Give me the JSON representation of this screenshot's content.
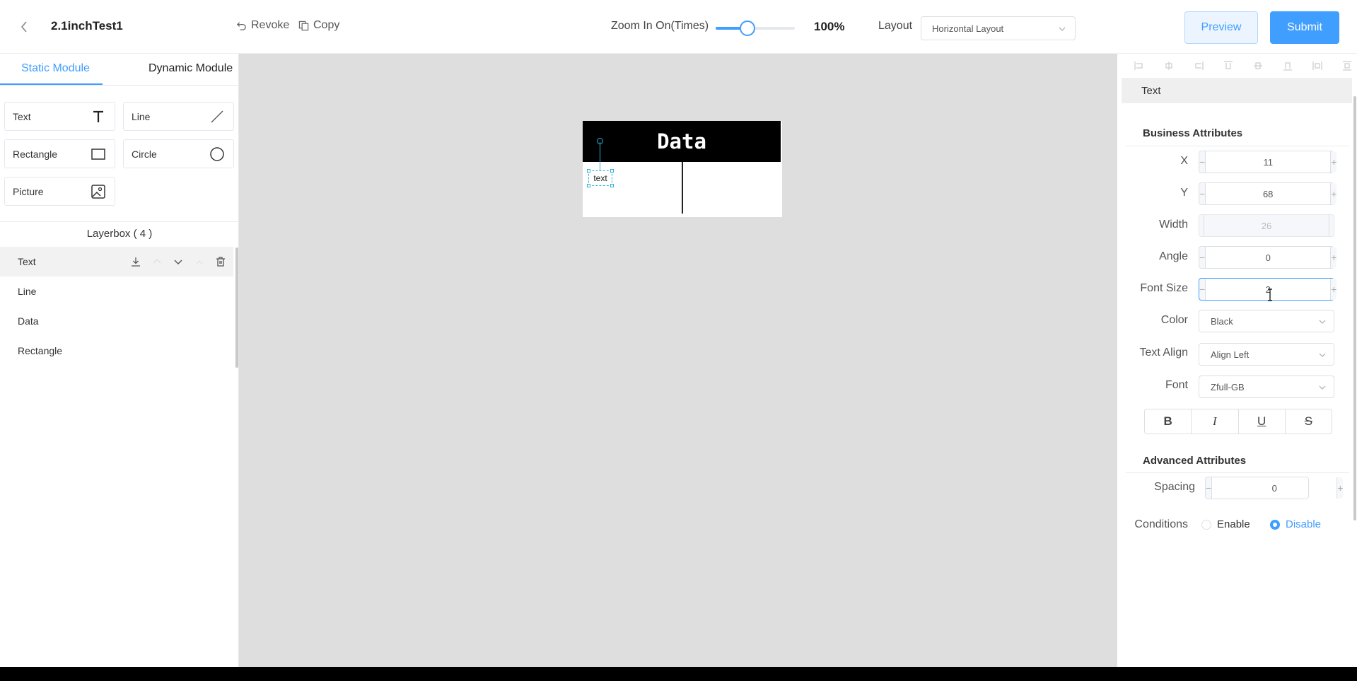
{
  "header": {
    "title": "2.1inchTest1",
    "revoke_label": "Revoke",
    "copy_label": "Copy",
    "zoom_label": "Zoom In On(Times)",
    "zoom_level": 0.4,
    "zoom_value": "100%",
    "layout_label": "Layout",
    "layout_value": "Horizontal Layout",
    "preview_label": "Preview",
    "submit_label": "Submit"
  },
  "left_panel": {
    "tabs": [
      {
        "label": "Static Module",
        "active": true
      },
      {
        "label": "Dynamic Module",
        "active": false
      }
    ],
    "tools": [
      {
        "label": "Text",
        "icon": "text-icon"
      },
      {
        "label": "Line",
        "icon": "line-icon"
      },
      {
        "label": "Rectangle",
        "icon": "rectangle-icon"
      },
      {
        "label": "Circle",
        "icon": "circle-icon"
      },
      {
        "label": "Picture",
        "icon": "picture-icon"
      }
    ],
    "layerbox_title": "Layerbox ( 4 )",
    "layers": [
      {
        "label": "Text",
        "active": true
      },
      {
        "label": "Line",
        "active": false
      },
      {
        "label": "Data",
        "active": false
      },
      {
        "label": "Rectangle",
        "active": false
      }
    ]
  },
  "canvas": {
    "header_text": "Data",
    "selected_text": "text"
  },
  "right_panel": {
    "type_label": "Text",
    "business_title": "Business Attributes",
    "x_label": "X",
    "x_value": "11",
    "y_label": "Y",
    "y_value": "68",
    "width_label": "Width",
    "width_value": "26",
    "angle_label": "Angle",
    "angle_value": "0",
    "font_size_label": "Font Size",
    "font_size_value": "2",
    "color_label": "Color",
    "color_value": "Black",
    "text_align_label": "Text Align",
    "text_align_value": "Align Left",
    "font_label": "Font",
    "font_value": "Zfull-GB",
    "style_buttons": [
      "B",
      "I",
      "U",
      "S"
    ],
    "advanced_title": "Advanced Attributes",
    "spacing_label": "Spacing",
    "spacing_value": "0",
    "conditions_label": "Conditions",
    "enable_label": "Enable",
    "disable_label": "Disable",
    "conditions_selected": "Disable"
  },
  "colors": {
    "accent": "#409eff",
    "canvas_bg": "#dedede",
    "selection": "#2bb0d8"
  }
}
